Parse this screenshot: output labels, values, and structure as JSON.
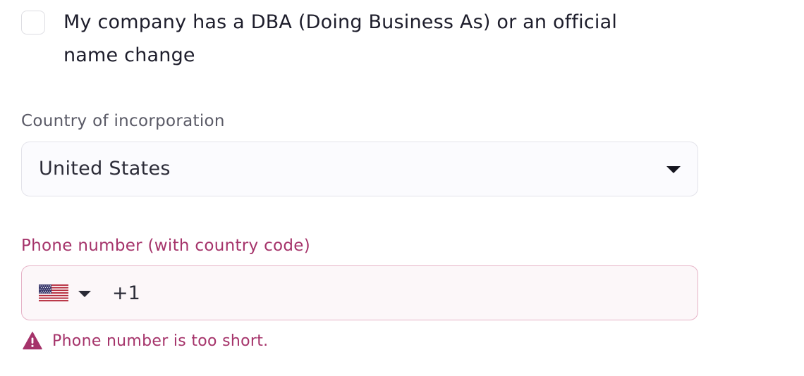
{
  "dba": {
    "checked": false,
    "label": "My company has a DBA (Doing Business As) or an official name change"
  },
  "country": {
    "label": "Country of incorporation",
    "selected": "United States"
  },
  "phone": {
    "label": "Phone number (with country code)",
    "country_flag": "us-flag-icon",
    "value": "+1"
  },
  "error": {
    "icon": "warning-icon",
    "message": "Phone number is too short."
  },
  "colors": {
    "error": "#a5336a",
    "error_border": "#e6b3c7",
    "text": "#1d1d2b",
    "muted": "#5a5a66"
  }
}
